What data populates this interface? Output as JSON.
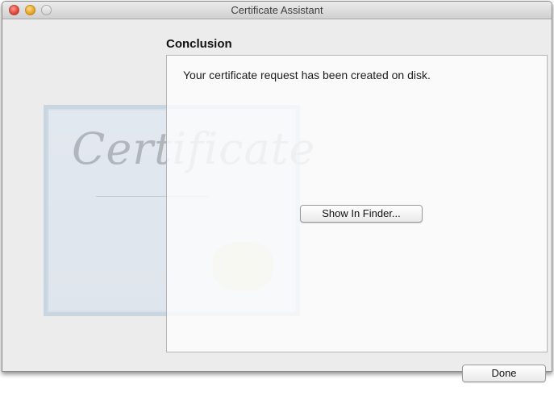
{
  "window": {
    "title": "Certificate Assistant"
  },
  "artwork": {
    "word": "Certificate"
  },
  "section": {
    "heading": "Conclusion",
    "message": "Your certificate request has been created on disk."
  },
  "buttons": {
    "show_in_finder": "Show In Finder...",
    "done": "Done"
  },
  "icons": {
    "close": "close-icon",
    "minimize": "minimize-icon",
    "zoom": "zoom-icon"
  }
}
